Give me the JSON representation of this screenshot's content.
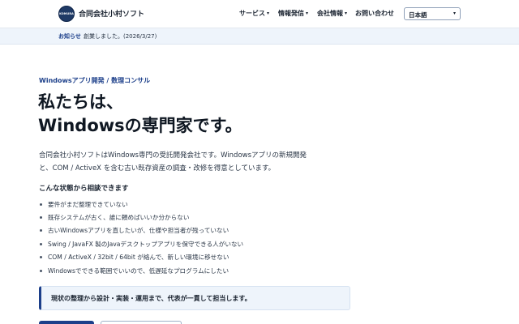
{
  "header": {
    "logo_text": "KOMURA",
    "brand": "合同会社小村ソフト",
    "nav": [
      {
        "label": "サービス"
      },
      {
        "label": "情報発信"
      },
      {
        "label": "会社情報"
      },
      {
        "label": "お問い合わせ"
      }
    ],
    "language": "日本語"
  },
  "notice": {
    "label": "お知らせ",
    "text": "創業しました。(2026/3/27)"
  },
  "hero": {
    "kicker": "Windowsアプリ開発 / 数理コンサル",
    "title_line1": "私たちは、",
    "title_line2": "Windowsの専門家です。",
    "lead": "合同会社小村ソフトはWindows専門の受託開発会社です。Windowsアプリの新規開発と、COM / ActiveX を含む古い既存資産の調査・改修を得意としています。",
    "subheading": "こんな状態から相談できます",
    "items": [
      "要件がまだ整理できていない",
      "既存システムが古く、誰に頼めばいいか分からない",
      "古いWindowsアプリを直したいが、仕様や担当者が残っていない",
      "Swing / JavaFX 製のJavaデスクトップアプリを保守できる人がいない",
      "COM / ActiveX / 32bit / 64bit が絡んで、新しい環境に移せない",
      "Windowsでできる範囲でいいので、低遅延なプログラムにしたい"
    ],
    "callout": "現状の整理から設計・実装・運用まで、代表が一貫して担当します。"
  }
}
